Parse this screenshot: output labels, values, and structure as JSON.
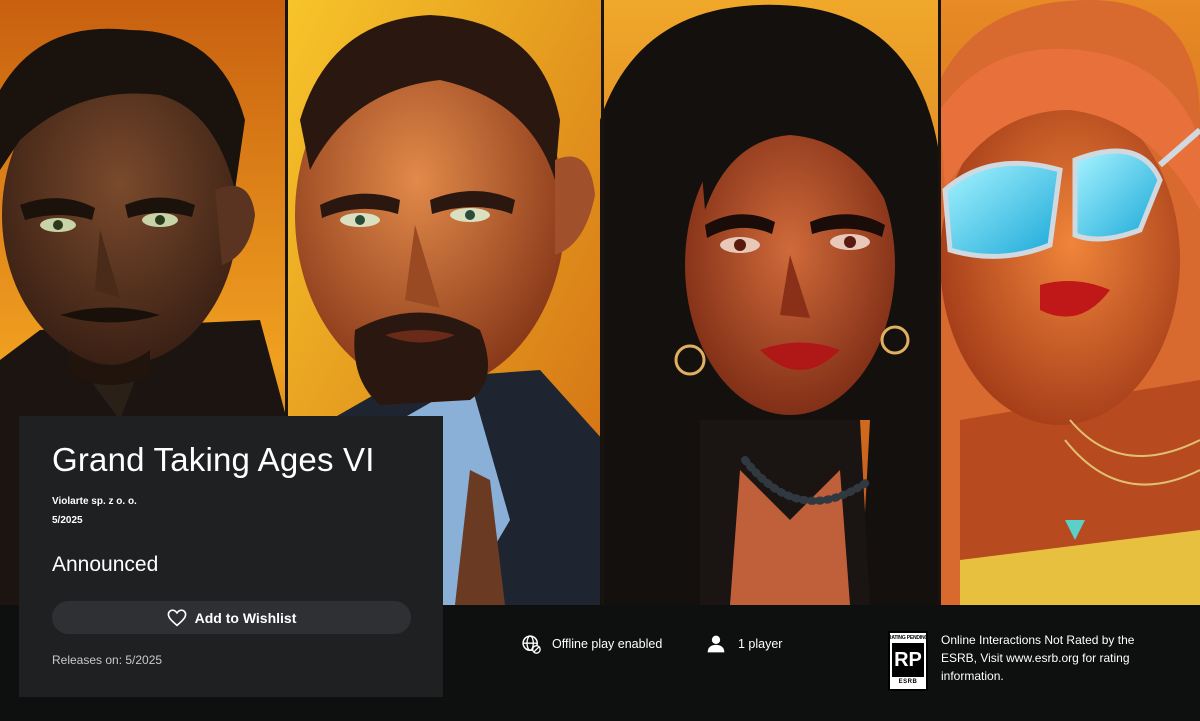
{
  "game": {
    "title": "Grand Taking Ages VI",
    "publisher": "Violarte sp. z o. o.",
    "release_date": "5/2025",
    "status": "Announced",
    "releases_on": "Releases on: 5/2025"
  },
  "actions": {
    "wishlist_label": "Add to Wishlist",
    "wishlist_icon": "heart-outline-icon"
  },
  "features": [
    {
      "label": "Offline play enabled",
      "icon": "globe-offline-icon"
    },
    {
      "label": "1 player",
      "icon": "person-icon"
    }
  ],
  "rating": {
    "badge_top": "RATING PENDING",
    "badge_code": "RP",
    "badge_brand": "ESRB",
    "description": "Online Interactions Not Rated by the ESRB, Visit www.esrb.org for rating information."
  },
  "colors": {
    "card_bg": "#1f2022",
    "page_bg": "#0e0f0f",
    "button_bg": "#2e3033",
    "hero_orange": "#e0801a"
  }
}
